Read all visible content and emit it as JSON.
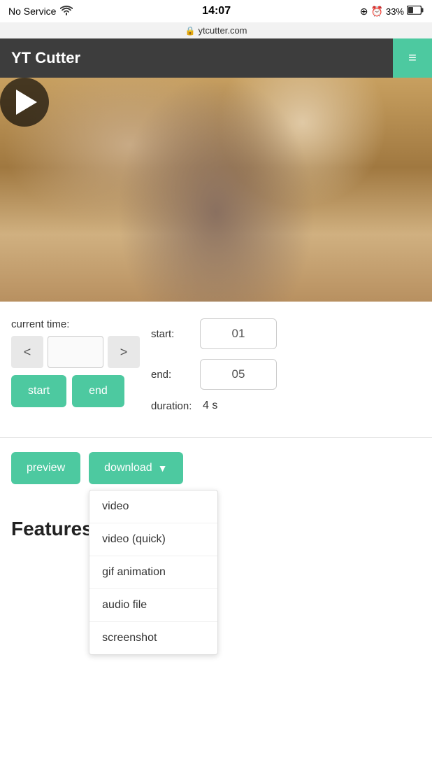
{
  "statusBar": {
    "signal": "No Service",
    "wifi": "wifi",
    "time": "14:07",
    "icons_right": "⊕ ⏰",
    "battery": "33%",
    "url": "ytcutter.com"
  },
  "header": {
    "title": "YT Cutter",
    "menuIcon": "≡"
  },
  "video": {
    "playLabel": "play"
  },
  "controls": {
    "currentTimeLabel": "current time:",
    "prevBtn": "<",
    "nextBtn": ">",
    "startBtnLabel": "start",
    "endBtnLabel": "end",
    "startFieldLabel": "start:",
    "startValue": "01",
    "endFieldLabel": "end:",
    "endValue": "05",
    "durationLabel": "duration:",
    "durationValue": "4 s"
  },
  "actions": {
    "previewLabel": "preview",
    "downloadLabel": "download",
    "dropdownArrow": "▼",
    "dropdownItems": [
      {
        "label": "video"
      },
      {
        "label": "video (quick)"
      },
      {
        "label": "gif animation"
      },
      {
        "label": "audio file"
      },
      {
        "label": "screenshot"
      }
    ]
  },
  "features": {
    "title": "Features"
  }
}
